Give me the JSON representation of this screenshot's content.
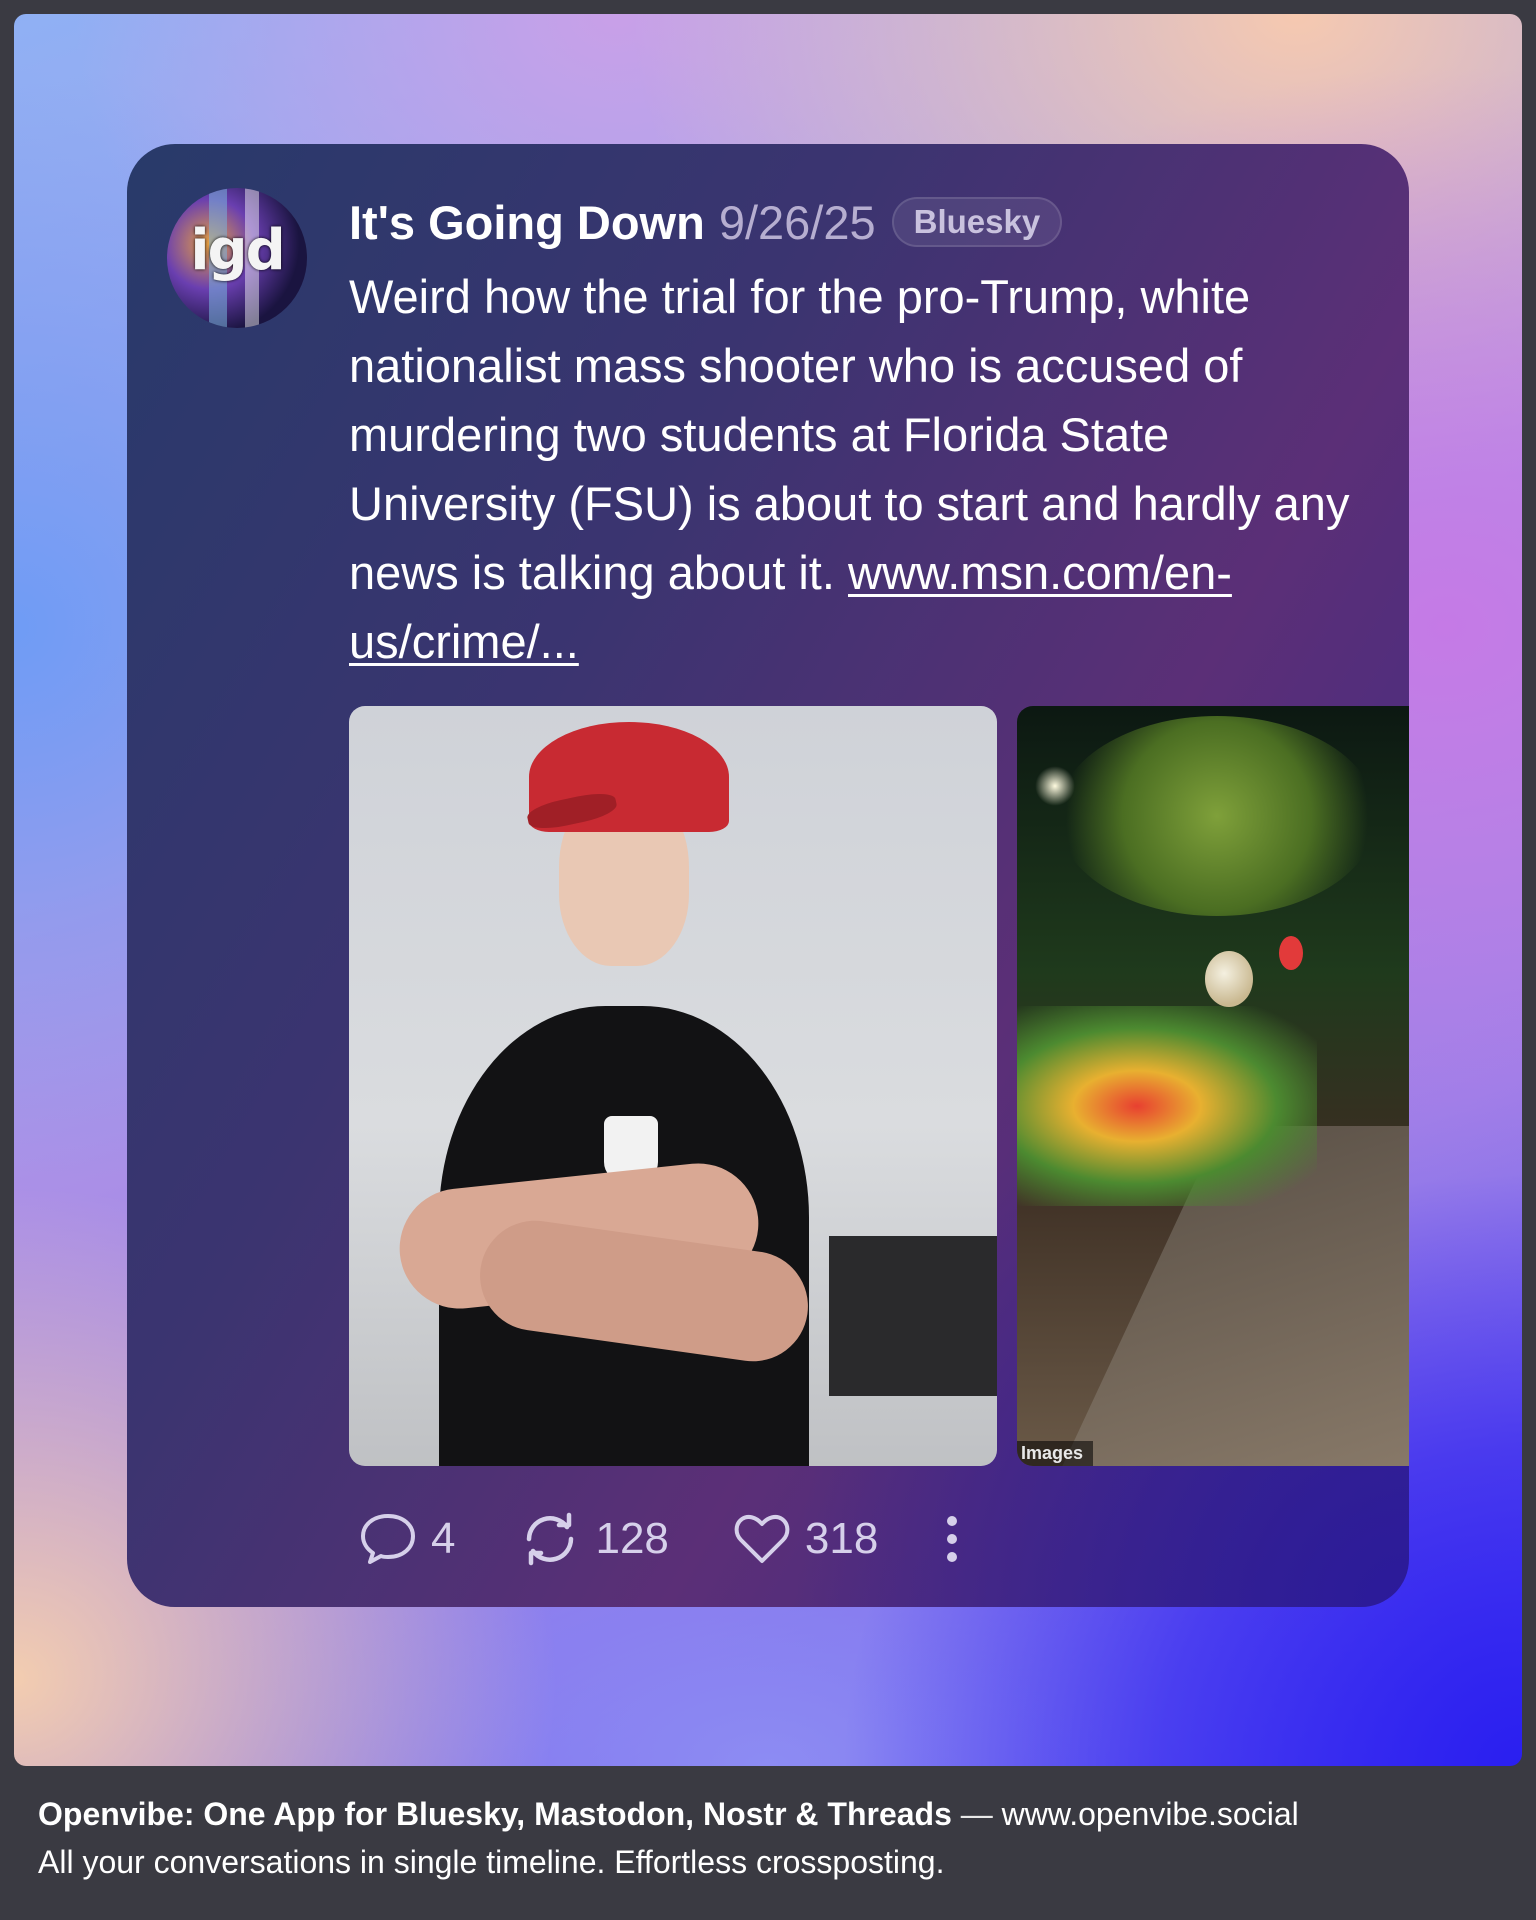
{
  "post": {
    "author": "It's Going Down",
    "date": "9/26/25",
    "network": "Bluesky",
    "avatar_text": "igd",
    "text_before_link": "Weird how the trial for the pro-Trump, white nationalist mass shooter who is accused of murdering two students at Florida State University (FSU) is about to start and hardly any news is talking about it. ",
    "link_text": "www.msn.com/en-us/crime/...",
    "images": [
      {
        "icon": "photo-person-in-red-cap"
      },
      {
        "icon": "photo-memorial-flowers",
        "credit": "Images"
      }
    ],
    "actions": {
      "replies": "4",
      "reposts": "128",
      "likes": "318"
    }
  },
  "footer": {
    "brand": "Openvibe: One App for Bluesky, Mastodon, Nostr & Threads",
    "dash": " — ",
    "url": "www.openvibe.social",
    "tagline": "All your conversations in single timeline. Effortless crossposting."
  },
  "colors": {
    "card_start": "#283a6a",
    "card_end": "#5b2f77",
    "text": "#ffffff",
    "muted": "#b6aed0"
  }
}
